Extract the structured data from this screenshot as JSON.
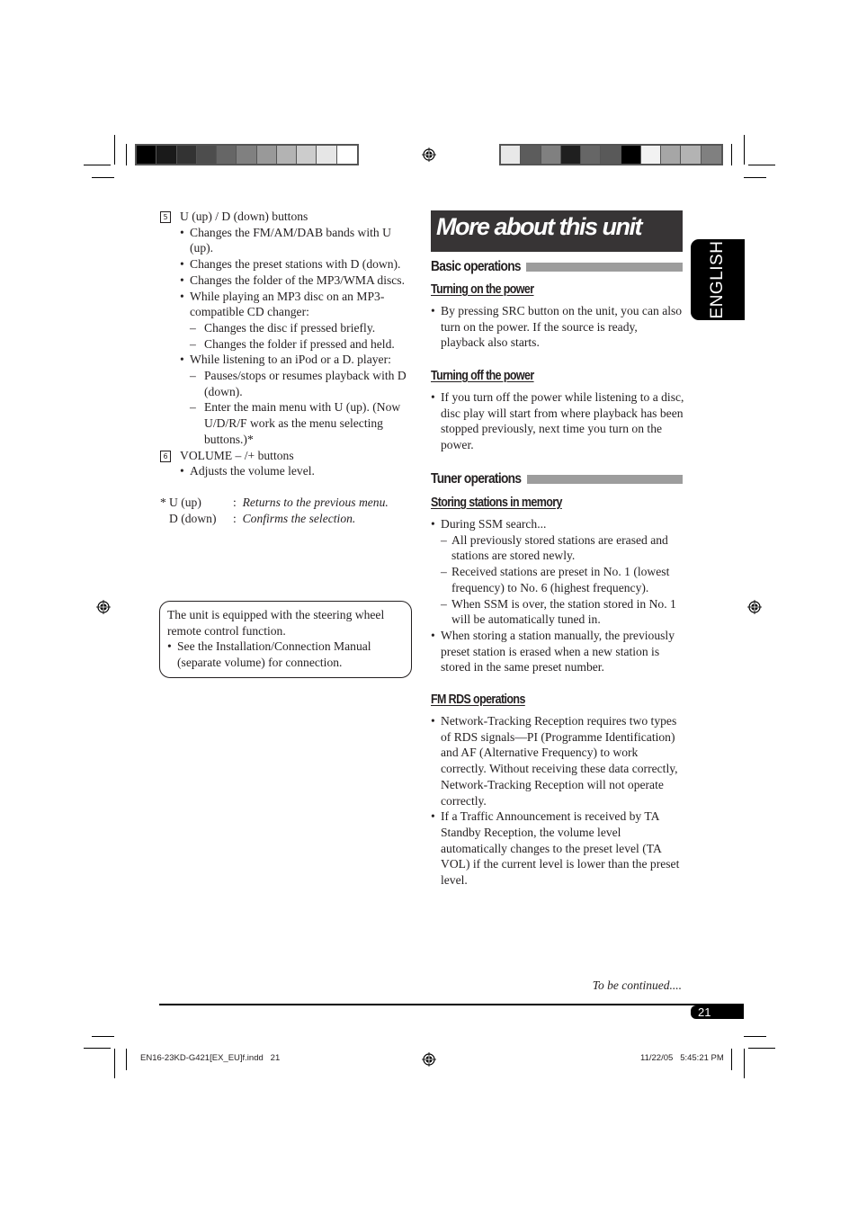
{
  "print_marks": {
    "left_color_bar": [
      "#000000",
      "#1a1a1a",
      "#333333",
      "#4d4d4d",
      "#666666",
      "#808080",
      "#999999",
      "#b3b3b3",
      "#cccccc",
      "#e6e6e6",
      "#ffffff"
    ],
    "right_color_bar": [
      "#e8e8e8",
      "#5c5c5c",
      "#808080",
      "#1f1f1f",
      "#666666",
      "#595959",
      "#000000",
      "#f2f2f2",
      "#a6a6a6",
      "#b3b3b3",
      "#808080"
    ]
  },
  "left_column": {
    "items": [
      {
        "number": "5",
        "heading": "U (up) / D (down) buttons",
        "bullets": [
          {
            "text": "Changes the FM/AM/DAB bands with U (up)."
          },
          {
            "text": "Changes the preset stations with D (down)."
          },
          {
            "text": "Changes the folder of the MP3/WMA discs."
          },
          {
            "text": "While playing an MP3 disc on an MP3-compatible CD changer:",
            "dashes": [
              "Changes the disc if pressed briefly.",
              "Changes the folder if pressed and held."
            ]
          },
          {
            "text": "While listening to an iPod or a D. player:",
            "dashes": [
              "Pauses/stops or resumes playback with D (down).",
              "Enter the main menu with U (up). (Now U/D/R/F work as the menu selecting buttons.)*"
            ]
          }
        ]
      },
      {
        "number": "6",
        "heading": "VOLUME – /+ buttons",
        "bullets": [
          {
            "text": "Adjusts the volume level."
          }
        ]
      }
    ],
    "footnote": {
      "marker": "*",
      "rows": [
        {
          "key": "U (up)",
          "sep": ":",
          "value": "Returns to the previous menu."
        },
        {
          "key": "D (down)",
          "sep": ":",
          "value": "Confirms the selection."
        }
      ]
    },
    "note_box": {
      "intro": "The unit is equipped with the steering wheel remote control function.",
      "bullet": "See the Installation/Connection Manual (separate volume) for connection."
    }
  },
  "right_column": {
    "title": "More about this unit",
    "sections": {
      "basic": {
        "heading": "Basic operations",
        "power_on": {
          "heading": "Turning on the power",
          "bullet": "By pressing SRC button on the unit, you can also turn on the power. If the source is ready, playback also starts."
        },
        "power_off": {
          "heading": "Turning off the power",
          "bullet": "If you turn off the power while listening to a disc, disc play will start from where playback has been stopped previously, next time you turn on the power."
        }
      },
      "tuner": {
        "heading": "Tuner operations",
        "storing": {
          "heading": "Storing stations in memory",
          "bullet1": "During SSM search...",
          "dashes": [
            "All previously stored stations are erased and stations are stored newly.",
            "Received stations are preset in No. 1 (lowest frequency) to No. 6 (highest frequency).",
            "When SSM is over, the station stored in No. 1 will be automatically tuned in."
          ],
          "bullet2": "When storing a station manually, the previously preset station is erased when a new station is stored in the same preset number."
        },
        "rds": {
          "heading": "FM RDS operations",
          "bullets": [
            "Network-Tracking Reception requires two types of RDS signals—PI (Programme Identification) and AF (Alternative Frequency) to work correctly. Without receiving these data correctly, Network-Tracking Reception will not operate correctly.",
            "If a Traffic Announcement is received by TA Standby Reception, the volume level automatically changes to the preset level (TA VOL) if the current level is lower than the preset level."
          ]
        }
      }
    }
  },
  "side_tab": {
    "label": "ENGLISH"
  },
  "footer": {
    "continued": "To be continued....",
    "page_number": "21",
    "slug_file": "EN16-23KD-G421[EX_EU]f.indd   21",
    "slug_date": "11/22/05   5:45:21 PM"
  }
}
